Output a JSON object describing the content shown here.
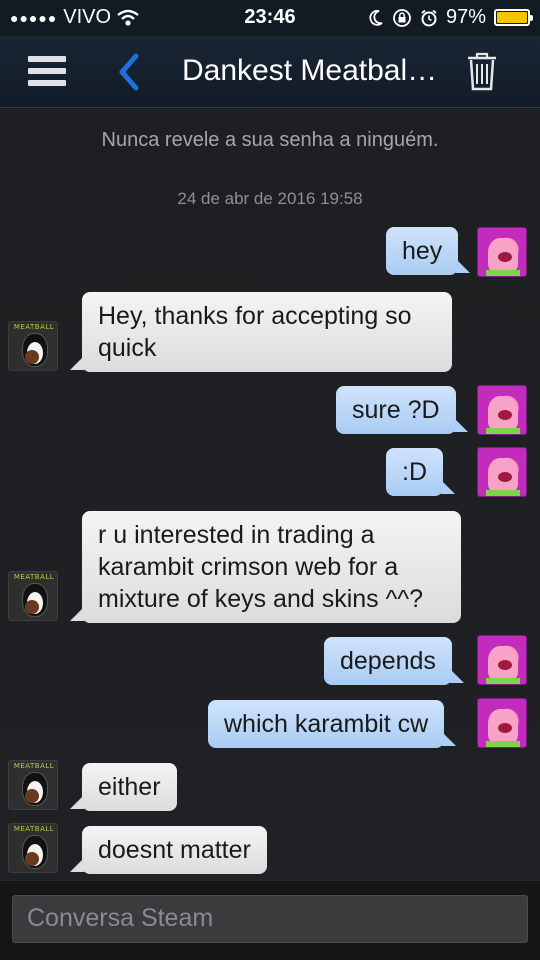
{
  "status_bar": {
    "signal_dots": "●●●●●",
    "carrier": "VIVO",
    "time": "23:46",
    "battery_percent": "97%",
    "icons": [
      "wifi-icon",
      "moon-icon",
      "rotation-lock-icon",
      "alarm-icon",
      "battery-icon"
    ]
  },
  "nav": {
    "title": "Dankest Meatball…",
    "icons": [
      "menu-icon",
      "back-icon",
      "trash-icon"
    ],
    "accent_color": "#1f6fe0"
  },
  "chat": {
    "notice": "Nunca revele a sua senha a ninguém.",
    "timestamp": "24 de abr de 2016 19:58",
    "friend_avatar_tag": "MEATBALL",
    "messages": [
      {
        "sender": "me",
        "text": "hey"
      },
      {
        "sender": "friend",
        "text": "Hey, thanks for accepting so quick"
      },
      {
        "sender": "me",
        "text": "sure ?D"
      },
      {
        "sender": "me",
        "text": ":D"
      },
      {
        "sender": "friend",
        "text": "r u interested in trading a karambit crimson web for a mixture of keys and skins ^^?"
      },
      {
        "sender": "me",
        "text": "depends"
      },
      {
        "sender": "me",
        "text": "which karambit cw"
      },
      {
        "sender": "friend",
        "text": "either"
      },
      {
        "sender": "friend",
        "text": "doesnt matter"
      }
    ]
  },
  "input": {
    "placeholder": "Conversa Steam"
  }
}
